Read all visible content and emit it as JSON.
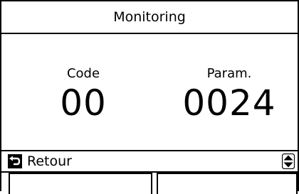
{
  "header": {
    "title": "Monitoring"
  },
  "main": {
    "code": {
      "label": "Code",
      "value": "00"
    },
    "param": {
      "label": "Param.",
      "value": "0024"
    }
  },
  "nav": {
    "back_label": "Retour",
    "back_icon": "back-arrow-icon",
    "scroll_icon": "up-down-scroll-icon"
  },
  "colors": {
    "foreground": "#000000",
    "background": "#ffffff"
  }
}
